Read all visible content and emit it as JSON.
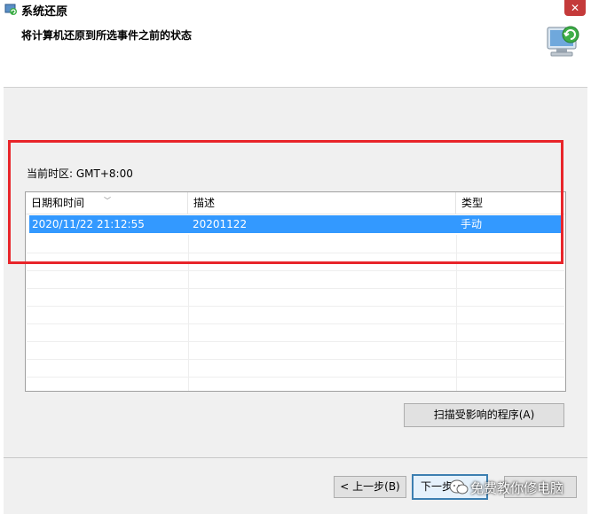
{
  "window": {
    "title": "系统还原",
    "close_glyph": "✕"
  },
  "header": {
    "title": "将计算机还原到所选事件之前的状态",
    "icon": "system-restore-icon"
  },
  "timezone_label": "当前时区: GMT+8:00",
  "table": {
    "columns": [
      "日期和时间",
      "描述",
      "类型"
    ],
    "rows": [
      {
        "datetime": "2020/11/22 21:12:55",
        "description": "20201122",
        "type": "手动"
      }
    ]
  },
  "buttons": {
    "scan": "扫描受影响的程序(A)",
    "back": "< 上一步(B)",
    "next": "下一步"
  },
  "watermark": "免费教你修电脑",
  "colors": {
    "selection": "#3399ff",
    "highlight_box": "#e8252a"
  }
}
